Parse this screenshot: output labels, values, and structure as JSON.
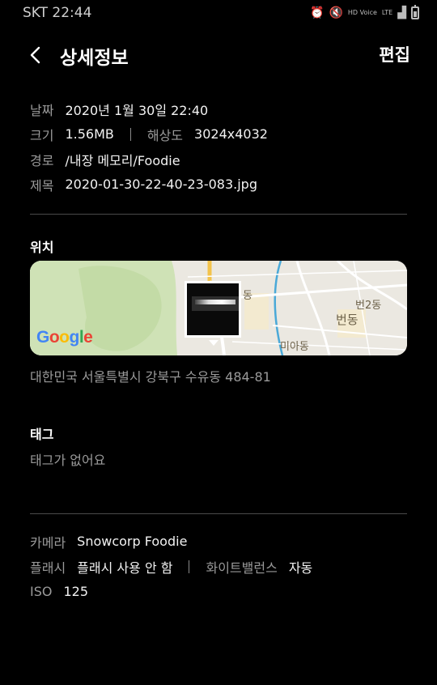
{
  "status": {
    "carrier_time": "SKT 22:44",
    "hd_voice": "HD Voice",
    "network": "LTE"
  },
  "header": {
    "title": "상세정보",
    "edit_label": "편집"
  },
  "details": {
    "date_label": "날짜",
    "date_value": "2020년 1월 30일 22:40",
    "size_label": "크기",
    "size_value": "1.56MB",
    "resolution_label": "해상도",
    "resolution_value": "3024x4032",
    "path_label": "경로",
    "path_value": "/내장 메모리/Foodie",
    "filename_label": "제목",
    "filename_value": "2020-01-30-22-40-23-083.jpg"
  },
  "location": {
    "title": "위치",
    "address": "대한민국 서울특별시 강북구 수유동 484-81",
    "map_labels": {
      "dong_partial": "동",
      "beon2dong": "번2동",
      "beondong": "번동",
      "miadong": "미아동"
    },
    "google_letters": [
      "G",
      "o",
      "o",
      "g",
      "l",
      "e"
    ],
    "google_colors": [
      "#4285F4",
      "#EA4335",
      "#FBBC05",
      "#4285F4",
      "#34A853",
      "#EA4335"
    ]
  },
  "tags": {
    "title": "태그",
    "empty_text": "태그가 없어요"
  },
  "camera": {
    "camera_label": "카메라",
    "camera_value": "Snowcorp Foodie",
    "flash_label": "플래시",
    "flash_value": "플래시 사용 안 함",
    "wb_label": "화이트밸런스",
    "wb_value": "자동",
    "iso_label": "ISO",
    "iso_value": "125"
  }
}
